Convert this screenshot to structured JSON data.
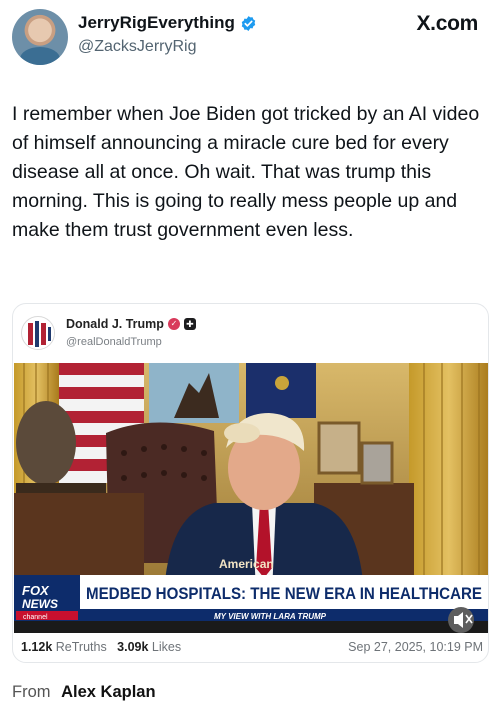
{
  "author": {
    "display_name": "JerryRigEverything",
    "handle": "@ZacksJerryRig"
  },
  "site_label": "X.com",
  "tweet_text": "I remember when Joe Biden got tricked by an AI video of himself announcing a miracle cure bed for every disease all at once. Oh wait. That was trump this morning. This is going to really mess people up and make them trust government even less.",
  "embedded_post": {
    "name": "Donald J. Trump",
    "handle": "@realDonaldTrump",
    "media": {
      "network_logo_top": "FOX",
      "network_logo_bottom": "NEWS",
      "network_logo_sub": "channel",
      "headline": "MEDBED HOSPITALS: THE NEW ERA IN HEALTHCARE",
      "subheadline": "MY VIEW WITH LARA TRUMP",
      "watermark": "American",
      "mute_icon": "speaker-muted-icon"
    },
    "retruths_count": "1.12k",
    "retruths_label": "ReTruths",
    "likes_count": "3.09k",
    "likes_label": "Likes",
    "timestamp": "Sep 27, 2025, 10:19 PM"
  },
  "attribution": {
    "prefix": "From",
    "name": "Alex Kaplan"
  },
  "colors": {
    "verified_blue": "#1d9bf0",
    "headline_blue": "#0d2c6b",
    "fox_red": "#c8102e"
  }
}
